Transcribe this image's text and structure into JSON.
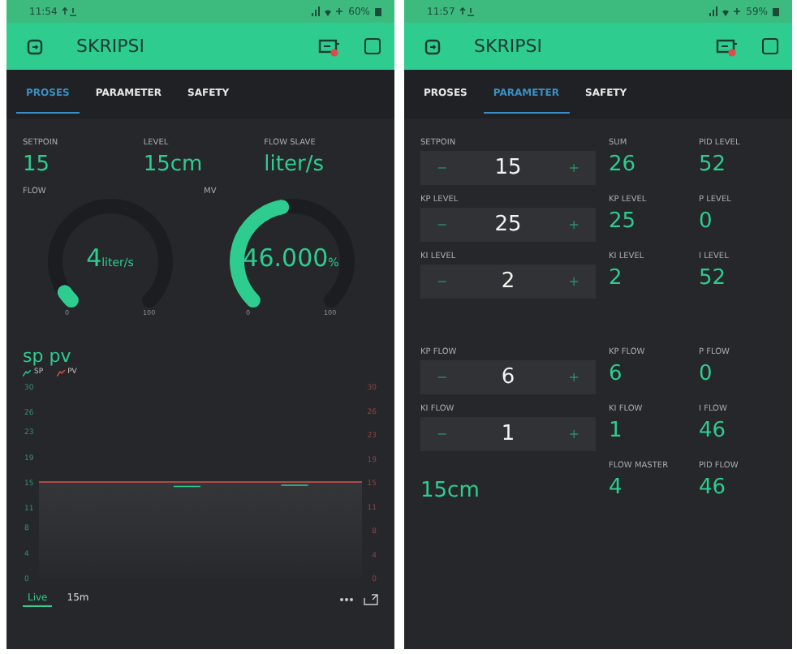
{
  "phones": [
    {
      "kind": "proses",
      "status": {
        "time": "11:54",
        "battery": "60%"
      },
      "title": "SKRIPSI",
      "tabs": [
        {
          "label": "PROSES",
          "selected": true
        },
        {
          "label": "PARAMETER",
          "selected": false
        },
        {
          "label": "SAFETY",
          "selected": false
        }
      ],
      "values": [
        {
          "label": "SETPOIN",
          "value": "15"
        },
        {
          "label": "LEVEL",
          "value": "15cm"
        },
        {
          "label": "FLOW SLAVE",
          "value": "liter/s"
        }
      ],
      "gauges": [
        {
          "label": "FLOW",
          "value": "4",
          "unit": "liter/s",
          "min": "0",
          "max": "100"
        },
        {
          "label": "MV",
          "value": "46.000",
          "unit": "%",
          "min": "0",
          "max": "100"
        }
      ],
      "chart": {
        "title": "sp pv",
        "right_axis_labels": [
          "30",
          "26",
          "23",
          "19",
          "15",
          "11",
          "8",
          "4",
          "0"
        ],
        "chart_data": {
          "type": "line",
          "ylim": [
            0,
            30
          ],
          "yticks": [
            0,
            4,
            8,
            11,
            15,
            19,
            23,
            26,
            30
          ],
          "series": [
            {
              "name": "SP",
              "color": "#2ecc8f",
              "values": [
                null,
                null,
                null,
                null,
                null,
                14.3,
                14.3,
                null,
                null,
                14.5,
                14.5,
                null,
                null
              ]
            },
            {
              "name": "PV",
              "color": "#d9534f",
              "values": [
                15,
                15,
                15,
                15,
                15,
                15,
                15,
                15,
                15,
                15,
                15,
                15,
                15
              ]
            }
          ]
        },
        "ranges": [
          {
            "label": "Live",
            "selected": true
          },
          {
            "label": "15m",
            "selected": false
          }
        ]
      }
    },
    {
      "kind": "parameter",
      "status": {
        "time": "11:57",
        "battery": "59%"
      },
      "title": "SKRIPSI",
      "tabs": [
        {
          "label": "PROSES",
          "selected": false
        },
        {
          "label": "PARAMETER",
          "selected": true
        },
        {
          "label": "SAFETY",
          "selected": false
        }
      ],
      "groups": [
        {
          "rows": [
            {
              "control": {
                "kind": "stepper",
                "label": "SETPOIN",
                "value": "15",
                "decrement": "−",
                "increment": "+"
              },
              "displays": [
                {
                  "label": "SUM",
                  "value": "26"
                },
                {
                  "label": "PID LEVEL",
                  "value": "52"
                }
              ]
            },
            {
              "control": {
                "kind": "stepper",
                "label": "KP LEVEL",
                "value": "25",
                "decrement": "−",
                "increment": "+"
              },
              "displays": [
                {
                  "label": "KP LEVEL",
                  "value": "25"
                },
                {
                  "label": "P LEVEL",
                  "value": "0"
                }
              ]
            },
            {
              "control": {
                "kind": "stepper",
                "label": "KI LEVEL",
                "value": "2",
                "decrement": "−",
                "increment": "+"
              },
              "displays": [
                {
                  "label": "KI LEVEL",
                  "value": "2"
                },
                {
                  "label": "I LEVEL",
                  "value": "52"
                }
              ]
            }
          ]
        },
        {
          "rows": [
            {
              "control": {
                "kind": "stepper",
                "label": "KP FLOW",
                "value": "6",
                "decrement": "−",
                "increment": "+"
              },
              "displays": [
                {
                  "label": "KP FLOW",
                  "value": "6"
                },
                {
                  "label": "P FLOW",
                  "value": "0"
                }
              ]
            },
            {
              "control": {
                "kind": "stepper",
                "label": "KI FLOW",
                "value": "1",
                "decrement": "−",
                "increment": "+"
              },
              "displays": [
                {
                  "label": "KI FLOW",
                  "value": "1"
                },
                {
                  "label": "I FLOW",
                  "value": "46"
                }
              ]
            },
            {
              "control": {
                "kind": "value",
                "value": "15cm"
              },
              "displays": [
                {
                  "label": "FLOW MASTER",
                  "value": "4"
                },
                {
                  "label": "PID FLOW",
                  "value": "46"
                }
              ]
            }
          ]
        }
      ]
    }
  ]
}
